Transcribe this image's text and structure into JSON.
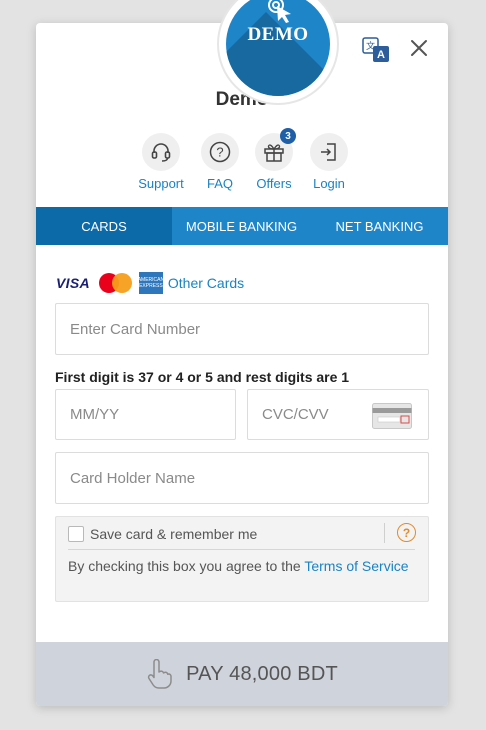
{
  "logo": {
    "text": "DEMO"
  },
  "merchant": {
    "name": "Demo"
  },
  "quick_links": [
    {
      "label": "Support",
      "icon": "headset-icon"
    },
    {
      "label": "FAQ",
      "icon": "question-icon"
    },
    {
      "label": "Offers",
      "icon": "gift-icon",
      "badge": "3"
    },
    {
      "label": "Login",
      "icon": "login-icon"
    }
  ],
  "tabs": [
    {
      "label": "CARDS",
      "active": true
    },
    {
      "label": "MOBILE BANKING",
      "active": false
    },
    {
      "label": "NET BANKING",
      "active": false
    }
  ],
  "card_brands": {
    "visa": "VISA",
    "amex": "AMERICAN EXPRESS",
    "other_cards": "Other Cards"
  },
  "form": {
    "card_number_placeholder": "Enter Card Number",
    "hint": "First digit is 37 or 4 or 5 and rest digits are 1",
    "expiry_placeholder": "MM/YY",
    "cvc_placeholder": "CVC/CVV",
    "holder_placeholder": "Card Holder Name"
  },
  "save_card": {
    "label": "Save card & remember me",
    "help": "?",
    "terms_prefix": "By checking this box you agree to the ",
    "terms_link": "Terms of Service"
  },
  "pay": {
    "label": "PAY 48,000 BDT"
  },
  "colors": {
    "accent": "#1f85c9",
    "active_tab": "#0d6aa9",
    "link": "#1a83c3",
    "pay_bar": "#cfd3dc"
  }
}
